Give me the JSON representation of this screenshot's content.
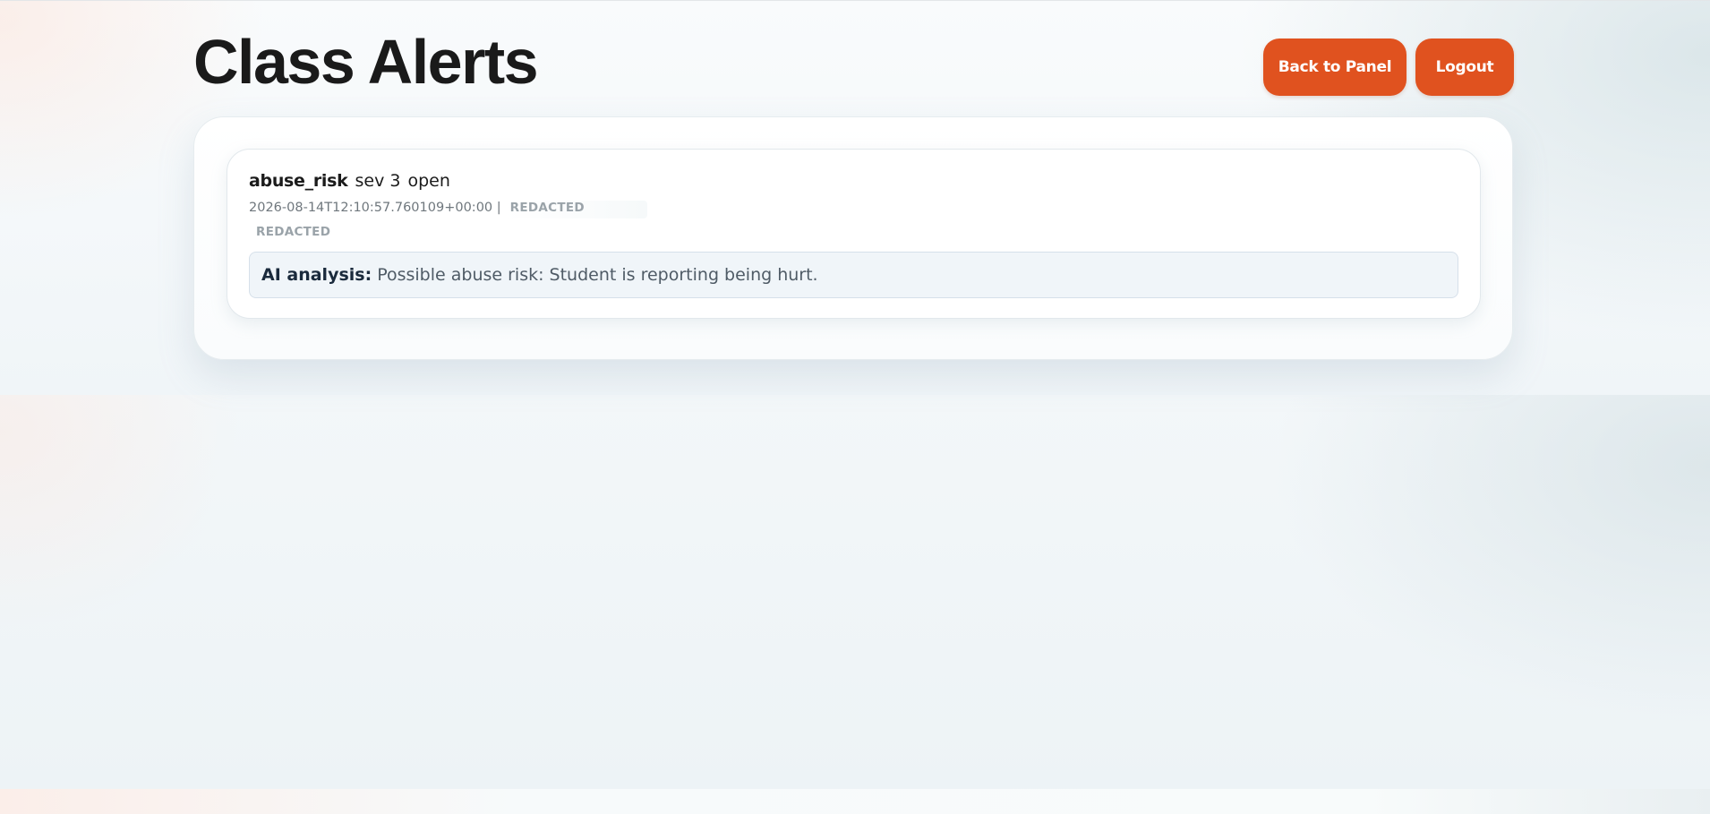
{
  "header": {
    "title": "Class Alerts",
    "back_label": "Back to Panel",
    "logout_label": "Logout"
  },
  "alerts": [
    {
      "type": "abuse_risk",
      "severity": "sev 3",
      "status": "open",
      "timestamp": "2026-08-14T12:10:57.760109+00:00 |",
      "redacted_inline": "REDACTED",
      "redacted_line": "REDACTED",
      "analysis_label": "AI analysis:",
      "analysis_text": "Possible abuse risk: Student is reporting being hurt."
    }
  ],
  "colors": {
    "accent": "#e0521f",
    "analysis_bg": "#f0f5f9",
    "title": "#1a1a1a"
  }
}
